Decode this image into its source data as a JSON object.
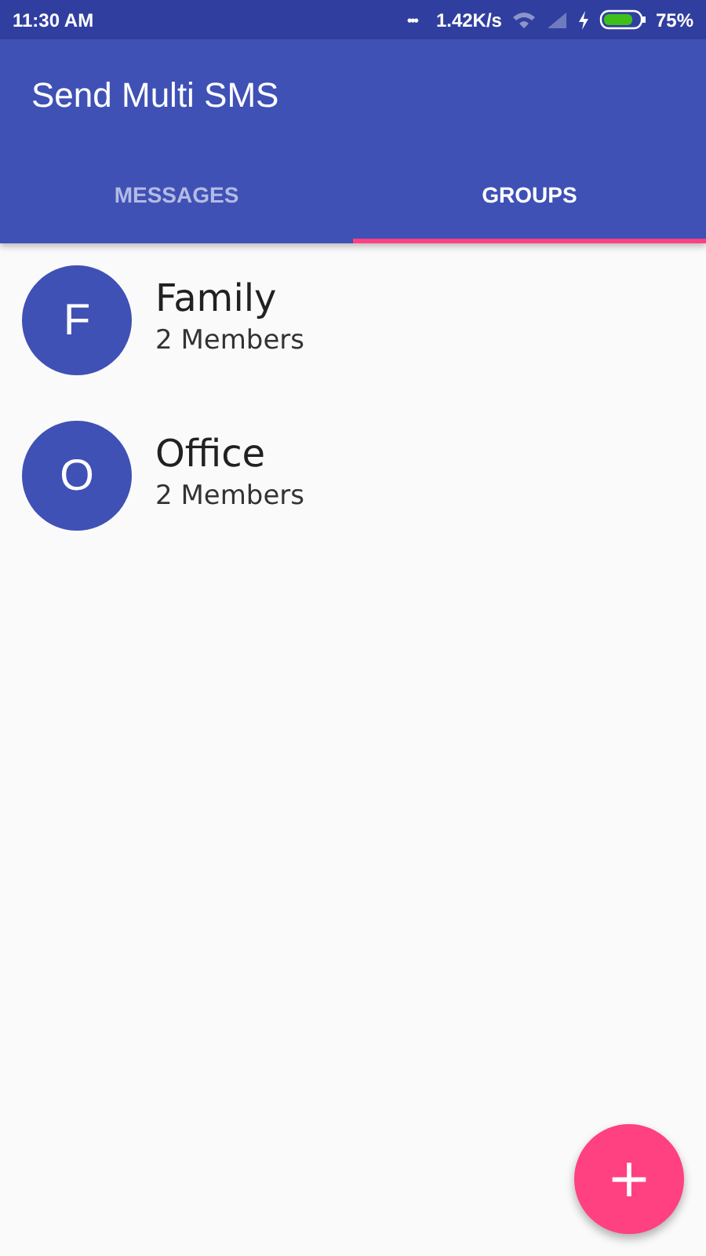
{
  "status_bar": {
    "time": "11:30 AM",
    "dots": "•••",
    "speed": "1.42K/s",
    "battery": "75%"
  },
  "app_bar": {
    "title": "Send Multi SMS"
  },
  "tabs": [
    {
      "label": "MESSAGES",
      "selected": false
    },
    {
      "label": "GROUPS",
      "selected": true
    }
  ],
  "groups": [
    {
      "initial": "F",
      "name": "Family",
      "members": "2 Members"
    },
    {
      "initial": "O",
      "name": "Office",
      "members": "2 Members"
    }
  ],
  "fab": {
    "label": "+"
  }
}
